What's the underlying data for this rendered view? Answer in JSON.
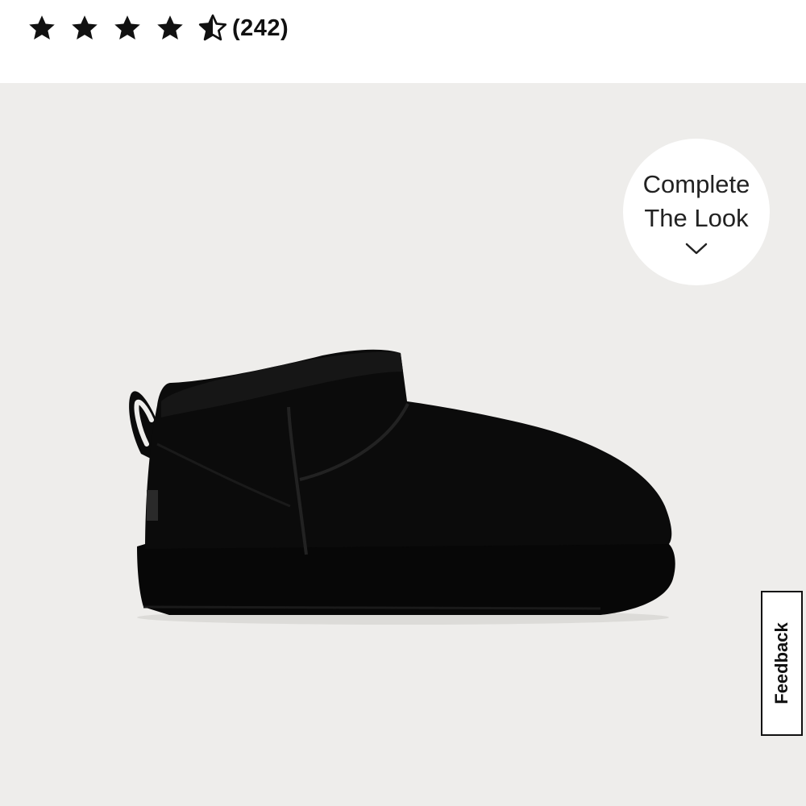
{
  "rating": {
    "value": 4.5,
    "max": 5,
    "review_count": "(242)"
  },
  "image_panel": {
    "complete_look": {
      "line1": "Complete",
      "line2": "The Look"
    },
    "feedback_label": "Feedback"
  },
  "colors": {
    "star": "#111111",
    "image_background": "#eeedeb",
    "boot": "#0b0b0b"
  },
  "icons": {
    "stars": "star-icon",
    "half_star": "half-star-icon",
    "complete_look": "chevron-down-icon"
  }
}
